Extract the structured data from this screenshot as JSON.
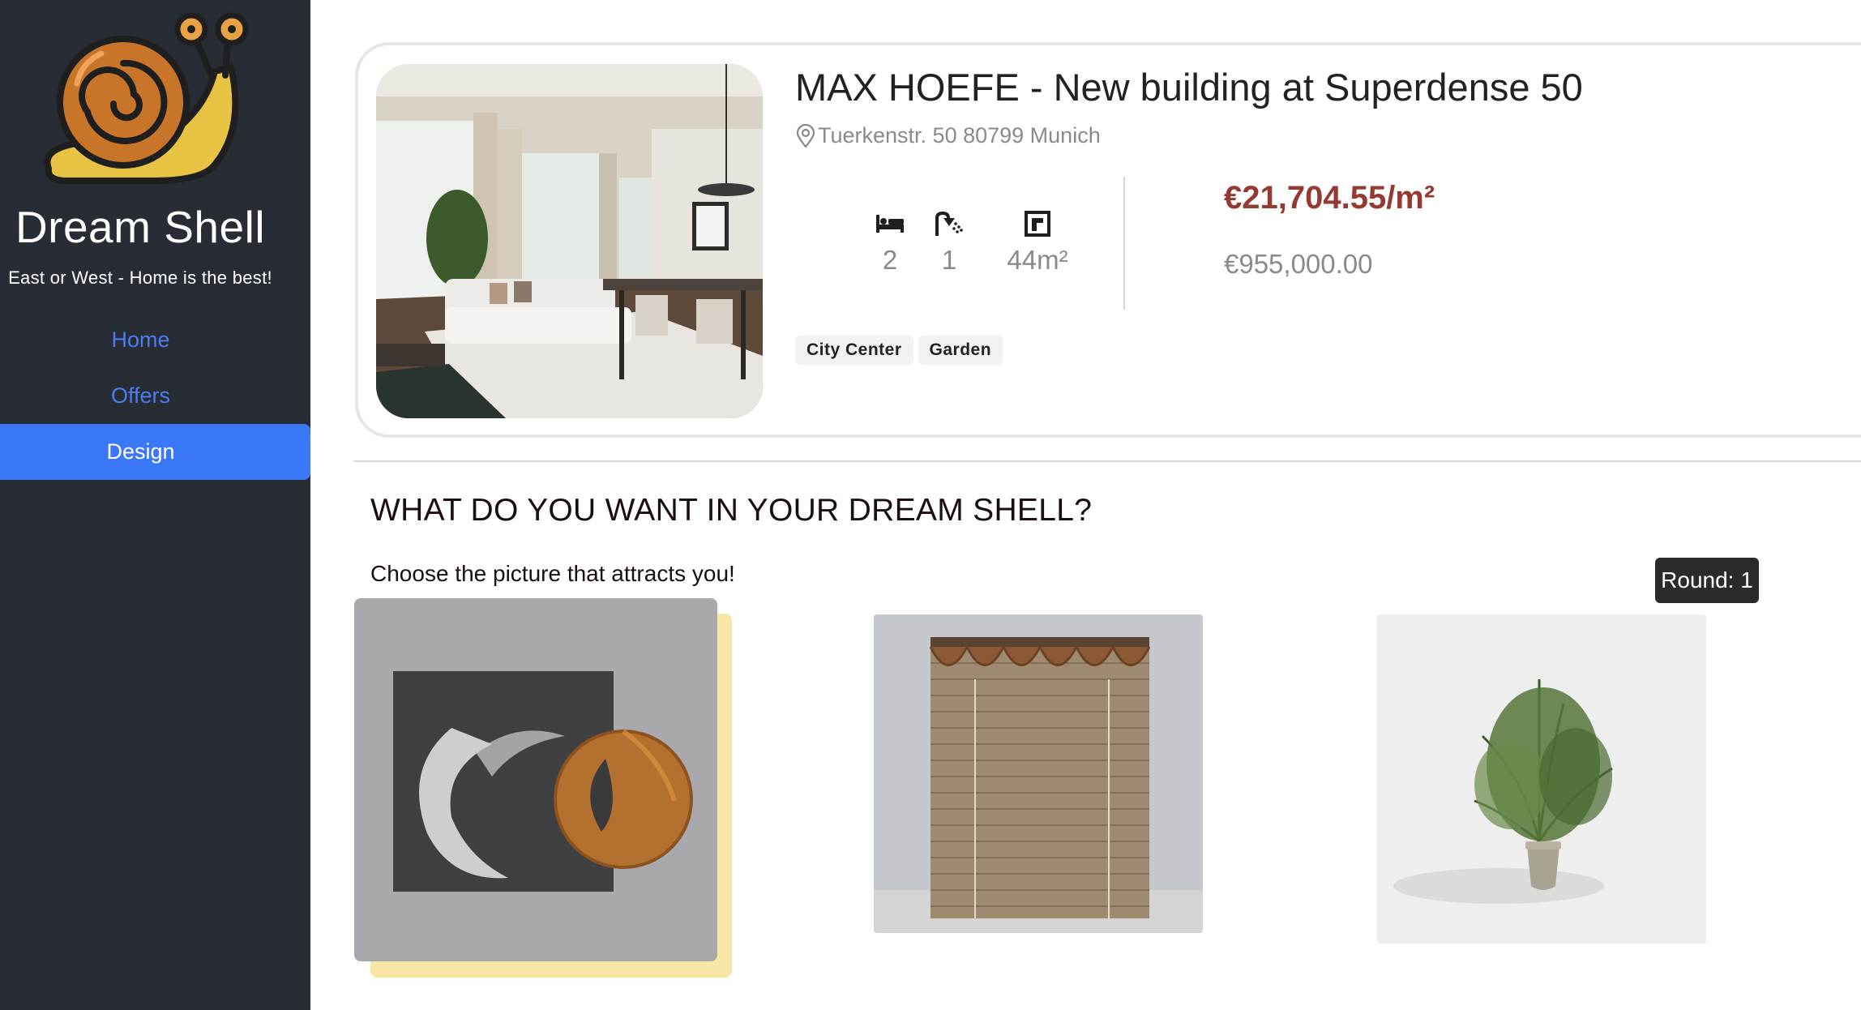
{
  "sidebar": {
    "brand_title": "Dream Shell",
    "tagline": "East or West - Home is the best!",
    "nav": [
      {
        "label": "Home",
        "active": false
      },
      {
        "label": "Offers",
        "active": false
      },
      {
        "label": "Design",
        "active": true
      }
    ]
  },
  "listing": {
    "title": "MAX HOEFE - New building at Superdense 50",
    "address": "Tuerkenstr. 50 80799 Munich",
    "stats": {
      "bedrooms": "2",
      "bathrooms": "1",
      "area": "44m²"
    },
    "price_per_sqm": "€21,704.55/m²",
    "price_total": "€955,000.00",
    "tags": [
      "City Center",
      "Garden"
    ]
  },
  "design": {
    "heading": "WHAT DO YOU WANT IN YOUR DREAM SHELL?",
    "subheading": "Choose the picture that attracts you!",
    "round_label": "Round: 1",
    "choices": [
      "abstract-art-image",
      "bamboo-blind-image",
      "potted-palm-image"
    ]
  },
  "colors": {
    "sidebar_bg": "#282c34",
    "nav_link": "#4c7df0",
    "nav_active_bg": "#3a78f7",
    "price_accent": "#953a32",
    "selection_highlight": "#f7e6a6"
  }
}
